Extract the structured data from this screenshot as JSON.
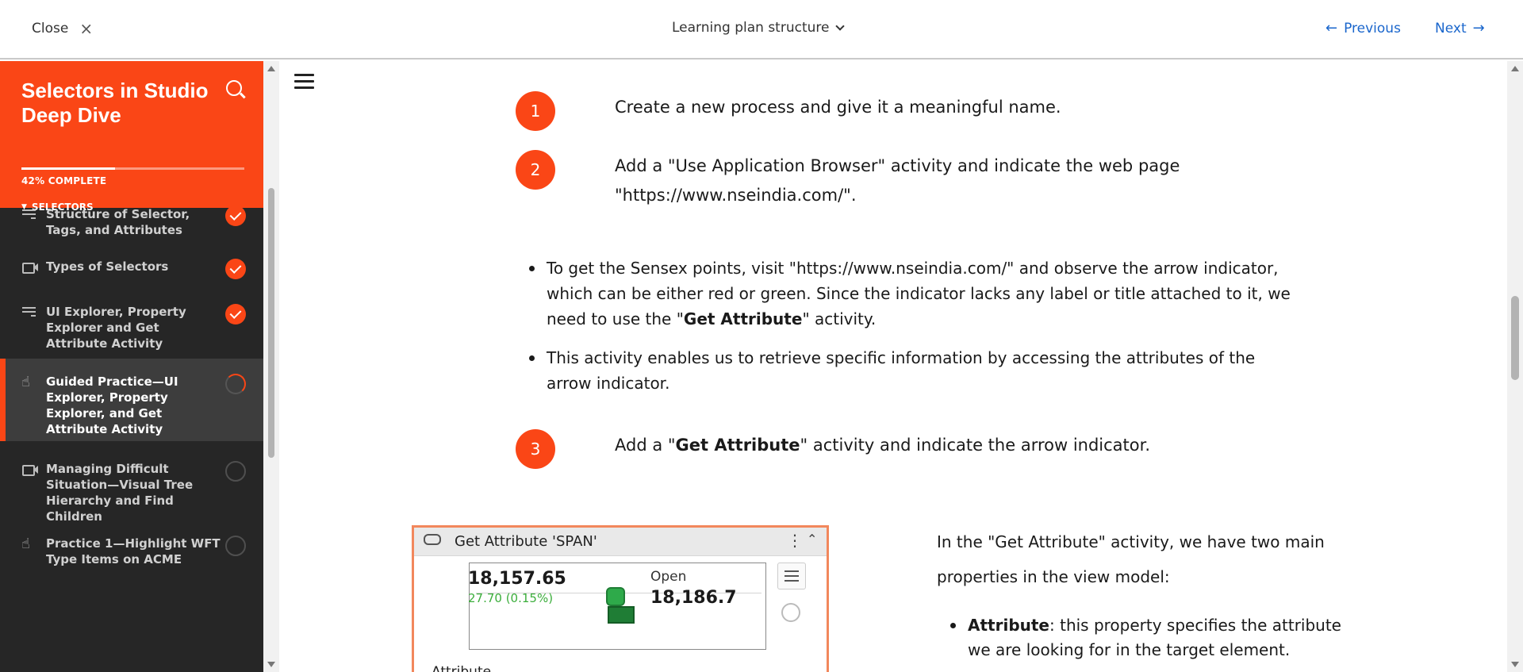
{
  "topbar": {
    "close_label": "Close",
    "close_icon": "×",
    "plan_title": "Learning plan structure",
    "previous_label": "Previous",
    "next_label": "Next",
    "arrow_left": "←",
    "arrow_right": "→"
  },
  "sidebar": {
    "course_title": "Selectors in Studio Deep Dive",
    "progress": 0.42,
    "progress_text": "42% COMPLETE",
    "section_label": "SELECTORS",
    "caret": "▼",
    "items": [
      {
        "label": "Structure of Selector, Tags, and Attributes",
        "icon": "lesson-lines-icon",
        "status": "complete"
      },
      {
        "label": "Types of Selectors",
        "icon": "video-icon",
        "status": "complete"
      },
      {
        "label": "UI Explorer, Property Explorer and Get Attribute Activity",
        "icon": "lesson-lines-icon",
        "status": "complete"
      },
      {
        "label": "Guided Practice—UI Explorer, Property Explorer, and Get Attribute Activity",
        "icon": "hand-pointer-icon",
        "status": "in-progress"
      },
      {
        "label": "Managing Difficult Situation—Visual Tree Hierarchy and Find Children",
        "icon": "video-icon",
        "status": "not-started"
      },
      {
        "label": "Practice 1—Highlight WFT Type Items on ACME",
        "icon": "hand-pointer-icon",
        "status": "not-started"
      }
    ]
  },
  "content": {
    "steps": [
      {
        "number": "1",
        "text": "Create a new process and give it a meaningful name."
      },
      {
        "number": "2",
        "text_line1": "Add a \"Use Application Browser\" activity and indicate the web page",
        "text_line2": "\"https://www.nseindia.com/\"."
      },
      {
        "number": "3",
        "text_before": "Add a \"",
        "text_bold": "Get Attribute",
        "text_after": "\" activity and indicate the arrow indicator."
      }
    ],
    "bullet1_before": "To get the Sensex points, visit \"https://www.nseindia.com/\" and observe the arrow indicator, which can be either red or green. Since the indicator lacks any label or title attached to it, we need to use the \"",
    "bullet1_bold": "Get Attribute",
    "bullet1_after": "\" activity.",
    "bullet2": "This activity enables us to retrieve specific information by accessing the attributes of the arrow indicator.",
    "activity": {
      "title": "Get Attribute 'SPAN'",
      "price": "18,157.65",
      "change": "27.70 (0.15%)",
      "open_label": "Open",
      "open_value": "18,186.7",
      "attribute_label": "Attribute",
      "dots": "⋮",
      "collapse": "⌃"
    },
    "side_paragraph": "In the \"Get Attribute\" activity, we have two main properties in the view model:",
    "side_bullet_bold": "Attribute",
    "side_bullet_text": ": this property specifies the attribute we are looking for in the target element."
  },
  "colors": {
    "accent": "#fa4616",
    "link": "#1a66cc",
    "sidebar_bg": "#262626"
  }
}
